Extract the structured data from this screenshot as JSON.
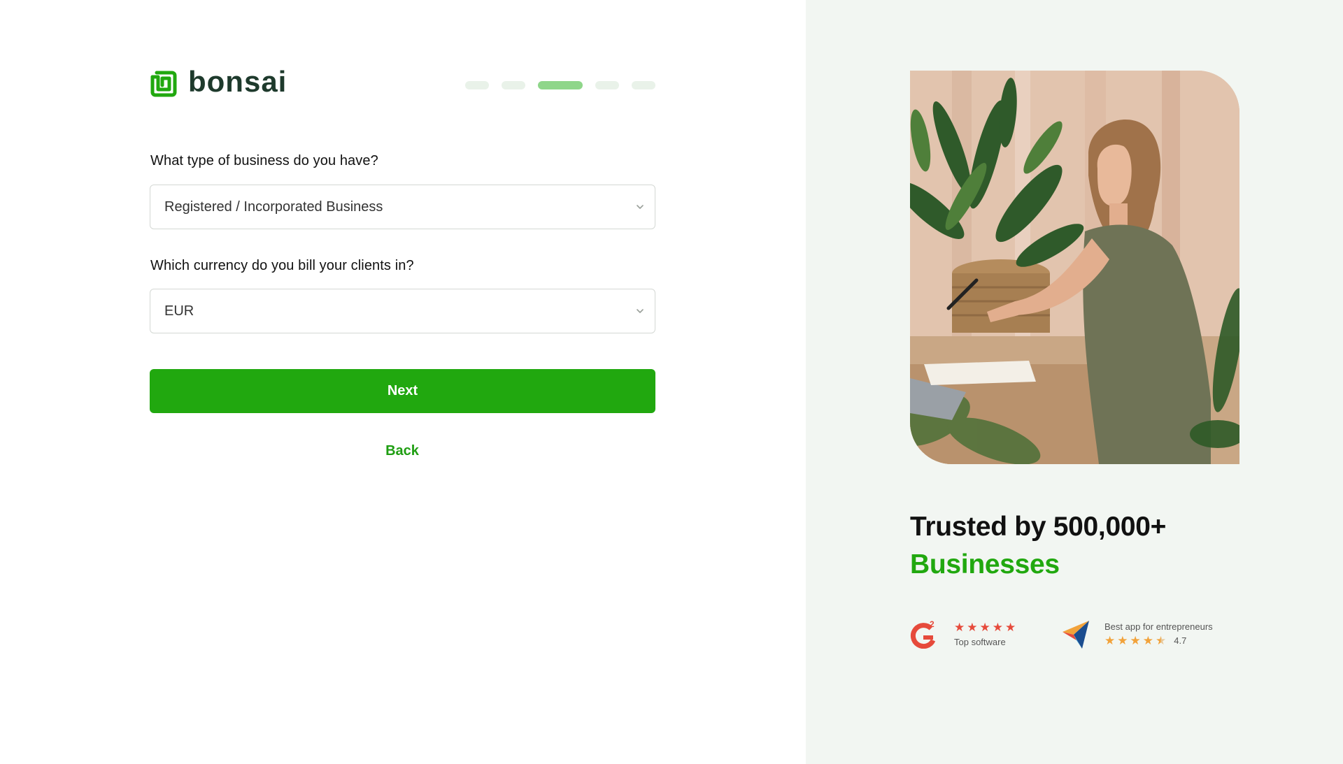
{
  "brand": {
    "name": "bonsai",
    "color": "#21a80f",
    "text_color": "#1e3a2c"
  },
  "steps": {
    "count": 5,
    "current": 3
  },
  "form": {
    "business_type": {
      "label": "What type of business do you have?",
      "value": "Registered / Incorporated Business"
    },
    "currency": {
      "label": "Which currency do you bill your clients in?",
      "value": "EUR"
    },
    "next_label": "Next",
    "back_label": "Back"
  },
  "promo": {
    "headline": "Trusted by 500,000+",
    "highlight": "Businesses",
    "g2": {
      "stars": 5,
      "caption": "Top software"
    },
    "capterra": {
      "caption": "Best app for entrepreneurs",
      "stars": 4.5,
      "rating": "4.7"
    }
  }
}
